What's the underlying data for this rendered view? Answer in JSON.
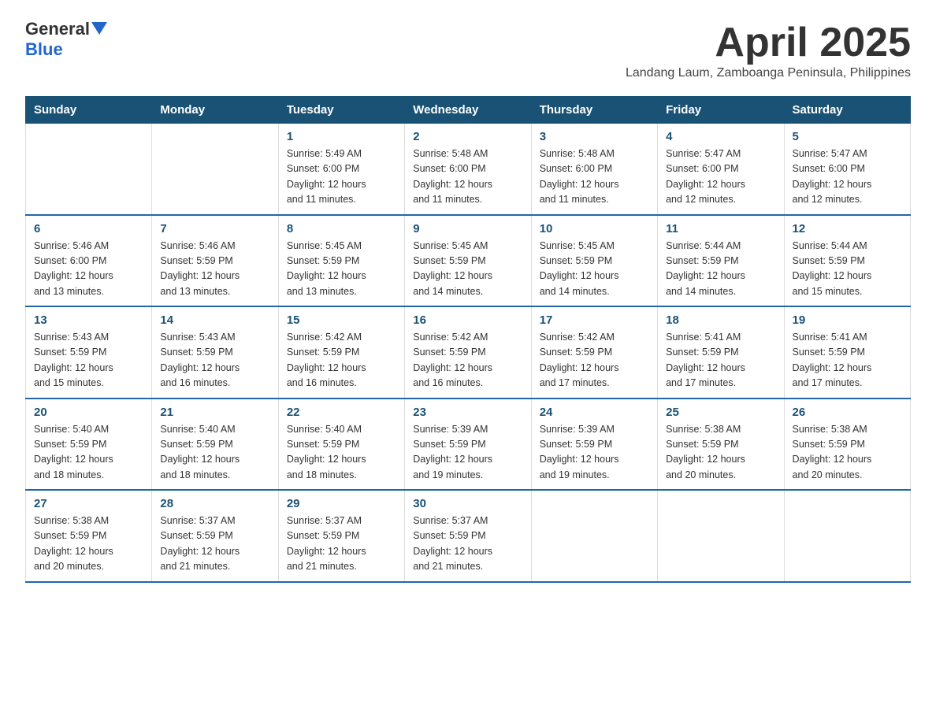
{
  "header": {
    "logo_general": "General",
    "logo_blue": "Blue",
    "month_title": "April 2025",
    "subtitle": "Landang Laum, Zamboanga Peninsula, Philippines"
  },
  "weekdays": [
    "Sunday",
    "Monday",
    "Tuesday",
    "Wednesday",
    "Thursday",
    "Friday",
    "Saturday"
  ],
  "weeks": [
    [
      {
        "day": "",
        "info": ""
      },
      {
        "day": "",
        "info": ""
      },
      {
        "day": "1",
        "info": "Sunrise: 5:49 AM\nSunset: 6:00 PM\nDaylight: 12 hours\nand 11 minutes."
      },
      {
        "day": "2",
        "info": "Sunrise: 5:48 AM\nSunset: 6:00 PM\nDaylight: 12 hours\nand 11 minutes."
      },
      {
        "day": "3",
        "info": "Sunrise: 5:48 AM\nSunset: 6:00 PM\nDaylight: 12 hours\nand 11 minutes."
      },
      {
        "day": "4",
        "info": "Sunrise: 5:47 AM\nSunset: 6:00 PM\nDaylight: 12 hours\nand 12 minutes."
      },
      {
        "day": "5",
        "info": "Sunrise: 5:47 AM\nSunset: 6:00 PM\nDaylight: 12 hours\nand 12 minutes."
      }
    ],
    [
      {
        "day": "6",
        "info": "Sunrise: 5:46 AM\nSunset: 6:00 PM\nDaylight: 12 hours\nand 13 minutes."
      },
      {
        "day": "7",
        "info": "Sunrise: 5:46 AM\nSunset: 5:59 PM\nDaylight: 12 hours\nand 13 minutes."
      },
      {
        "day": "8",
        "info": "Sunrise: 5:45 AM\nSunset: 5:59 PM\nDaylight: 12 hours\nand 13 minutes."
      },
      {
        "day": "9",
        "info": "Sunrise: 5:45 AM\nSunset: 5:59 PM\nDaylight: 12 hours\nand 14 minutes."
      },
      {
        "day": "10",
        "info": "Sunrise: 5:45 AM\nSunset: 5:59 PM\nDaylight: 12 hours\nand 14 minutes."
      },
      {
        "day": "11",
        "info": "Sunrise: 5:44 AM\nSunset: 5:59 PM\nDaylight: 12 hours\nand 14 minutes."
      },
      {
        "day": "12",
        "info": "Sunrise: 5:44 AM\nSunset: 5:59 PM\nDaylight: 12 hours\nand 15 minutes."
      }
    ],
    [
      {
        "day": "13",
        "info": "Sunrise: 5:43 AM\nSunset: 5:59 PM\nDaylight: 12 hours\nand 15 minutes."
      },
      {
        "day": "14",
        "info": "Sunrise: 5:43 AM\nSunset: 5:59 PM\nDaylight: 12 hours\nand 16 minutes."
      },
      {
        "day": "15",
        "info": "Sunrise: 5:42 AM\nSunset: 5:59 PM\nDaylight: 12 hours\nand 16 minutes."
      },
      {
        "day": "16",
        "info": "Sunrise: 5:42 AM\nSunset: 5:59 PM\nDaylight: 12 hours\nand 16 minutes."
      },
      {
        "day": "17",
        "info": "Sunrise: 5:42 AM\nSunset: 5:59 PM\nDaylight: 12 hours\nand 17 minutes."
      },
      {
        "day": "18",
        "info": "Sunrise: 5:41 AM\nSunset: 5:59 PM\nDaylight: 12 hours\nand 17 minutes."
      },
      {
        "day": "19",
        "info": "Sunrise: 5:41 AM\nSunset: 5:59 PM\nDaylight: 12 hours\nand 17 minutes."
      }
    ],
    [
      {
        "day": "20",
        "info": "Sunrise: 5:40 AM\nSunset: 5:59 PM\nDaylight: 12 hours\nand 18 minutes."
      },
      {
        "day": "21",
        "info": "Sunrise: 5:40 AM\nSunset: 5:59 PM\nDaylight: 12 hours\nand 18 minutes."
      },
      {
        "day": "22",
        "info": "Sunrise: 5:40 AM\nSunset: 5:59 PM\nDaylight: 12 hours\nand 18 minutes."
      },
      {
        "day": "23",
        "info": "Sunrise: 5:39 AM\nSunset: 5:59 PM\nDaylight: 12 hours\nand 19 minutes."
      },
      {
        "day": "24",
        "info": "Sunrise: 5:39 AM\nSunset: 5:59 PM\nDaylight: 12 hours\nand 19 minutes."
      },
      {
        "day": "25",
        "info": "Sunrise: 5:38 AM\nSunset: 5:59 PM\nDaylight: 12 hours\nand 20 minutes."
      },
      {
        "day": "26",
        "info": "Sunrise: 5:38 AM\nSunset: 5:59 PM\nDaylight: 12 hours\nand 20 minutes."
      }
    ],
    [
      {
        "day": "27",
        "info": "Sunrise: 5:38 AM\nSunset: 5:59 PM\nDaylight: 12 hours\nand 20 minutes."
      },
      {
        "day": "28",
        "info": "Sunrise: 5:37 AM\nSunset: 5:59 PM\nDaylight: 12 hours\nand 21 minutes."
      },
      {
        "day": "29",
        "info": "Sunrise: 5:37 AM\nSunset: 5:59 PM\nDaylight: 12 hours\nand 21 minutes."
      },
      {
        "day": "30",
        "info": "Sunrise: 5:37 AM\nSunset: 5:59 PM\nDaylight: 12 hours\nand 21 minutes."
      },
      {
        "day": "",
        "info": ""
      },
      {
        "day": "",
        "info": ""
      },
      {
        "day": "",
        "info": ""
      }
    ]
  ]
}
